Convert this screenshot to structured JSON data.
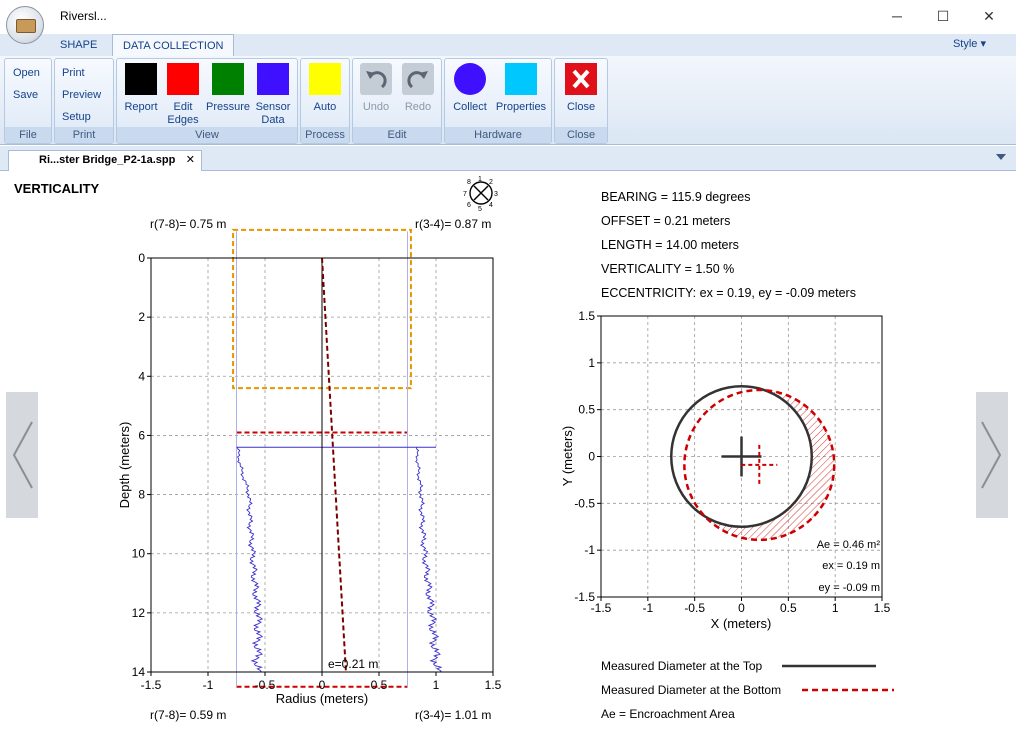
{
  "window": {
    "title": "Riversl...",
    "minimize": "─",
    "maximize": "☐",
    "close": "✕"
  },
  "tabs": [
    {
      "label": "SHAPE",
      "active": false
    },
    {
      "label": "DATA COLLECTION",
      "active": true
    }
  ],
  "style_menu": "Style ▾",
  "ribbon": {
    "file": {
      "label": "File",
      "open": "Open",
      "save": "Save"
    },
    "print": {
      "label": "Print",
      "print": "Print",
      "preview": "Preview",
      "setup": "Setup"
    },
    "view": {
      "label": "View",
      "buttons": [
        {
          "label": "Report",
          "color": "#000000"
        },
        {
          "label": "Edit Edges",
          "color": "#ff0000"
        },
        {
          "label": "Pressure",
          "color": "#008000"
        },
        {
          "label": "Sensor Data",
          "color": "#3f10ff"
        }
      ]
    },
    "process": {
      "label": "Process",
      "auto": "Auto",
      "color": "#ffff00"
    },
    "edit": {
      "label": "Edit",
      "undo": "Undo",
      "redo": "Redo"
    },
    "hardware": {
      "label": "Hardware",
      "collect": "Collect",
      "properties": "Properties",
      "collect_color": "#3f10ff",
      "properties_color": "#00c8ff"
    },
    "close": {
      "label": "Close",
      "button": "Close"
    }
  },
  "document_tab": {
    "name": "Ri...ster Bridge_P2-1a.spp",
    "close": "✕"
  },
  "panel": {
    "title": "VERTICALITY",
    "compass": {
      "labels": [
        "1",
        "2",
        "3",
        "4",
        "5",
        "6",
        "7",
        "8"
      ]
    },
    "top_left_r": "r(7-8)= 0.75 m",
    "top_right_r": "r(3-4)= 0.87 m",
    "bottom_left_r": "r(7-8)= 0.59 m",
    "bottom_right_r": "r(3-4)= 1.01 m",
    "e_label": "e=0.21 m"
  },
  "info": {
    "bearing": "BEARING = 115.9 degrees",
    "offset": "OFFSET = 0.21 meters",
    "length": "LENGTH = 14.00 meters",
    "verticality": "VERTICALITY = 1.50 %",
    "eccentricity": "ECCENTRICITY: ex = 0.19, ey = -0.09 meters"
  },
  "annotations": {
    "ae": "Ae = 0.46 m²",
    "ex": "ex = 0.19 m",
    "ey": "ey = -0.09 m"
  },
  "legend": {
    "top": "Measured Diameter at the Top",
    "bottom": "Measured Diameter at the Bottom",
    "ae": "Ae = Encroachment Area"
  },
  "colors": {
    "top_line": "#333333",
    "bottom_line": "#cc0000",
    "box_orange": "#e69500",
    "sensor_blue": "#3a2fd0"
  },
  "chart_data": [
    {
      "type": "line",
      "xlabel": "Radius (meters)",
      "ylabel": "Depth (meters)",
      "xlim": [
        -1.5,
        1.5
      ],
      "ylim": [
        14,
        0
      ],
      "xticks": [
        "-1.5",
        "-1",
        "-0.5",
        "0",
        "0.5",
        "1",
        "1.5"
      ],
      "yticks": [
        "0",
        "2",
        "4",
        "6",
        "8",
        "10",
        "12",
        "14"
      ],
      "grid": true,
      "series": [
        {
          "kind": "reference-axis",
          "x": [
            0,
            0
          ],
          "y": [
            0,
            14
          ]
        },
        {
          "kind": "inclined-axis",
          "x": [
            0,
            0.21
          ],
          "y": [
            0,
            14
          ]
        },
        {
          "kind": "top-box",
          "x": [
            -0.78,
            0.78
          ],
          "y": [
            -0.95,
            4.4
          ]
        },
        {
          "kind": "bottom-box",
          "x": [
            -0.75,
            0.75
          ],
          "y": [
            5.9,
            14.5
          ]
        },
        {
          "kind": "sensor-frame",
          "x": [
            -0.75,
            0.75
          ],
          "y": [
            6.4,
            14
          ]
        },
        {
          "kind": "sensor-profile-left",
          "x": [
            -0.74,
            -0.72,
            -0.64,
            -0.63,
            -0.61,
            -0.59,
            -0.56,
            -0.57
          ],
          "y": [
            6.4,
            7,
            8,
            9,
            10,
            11,
            12,
            14
          ]
        },
        {
          "kind": "sensor-profile-right",
          "x": [
            0.83,
            0.84,
            0.87,
            0.88,
            0.9,
            0.93,
            0.96,
            1.01
          ],
          "y": [
            6.4,
            7,
            8,
            9,
            10,
            11,
            12,
            14
          ]
        }
      ]
    },
    {
      "type": "scatter",
      "xlabel": "X (meters)",
      "ylabel": "Y (meters)",
      "xlim": [
        -1.5,
        1.5
      ],
      "ylim": [
        -1.5,
        1.5
      ],
      "xticks": [
        "-1.5",
        "-1",
        "-0.5",
        "0",
        "0.5",
        "1",
        "1.5"
      ],
      "yticks": [
        "-1.5",
        "-1",
        "-0.5",
        "0",
        "0.5",
        "1",
        "1.5"
      ],
      "grid": true,
      "series": [
        {
          "name": "Measured Diameter at the Top",
          "shape": "circle",
          "center": [
            0,
            0
          ],
          "radius": 0.75
        },
        {
          "name": "Measured Diameter at the Bottom",
          "shape": "circle",
          "center": [
            0.19,
            -0.09
          ],
          "radius": 0.8
        }
      ]
    }
  ]
}
